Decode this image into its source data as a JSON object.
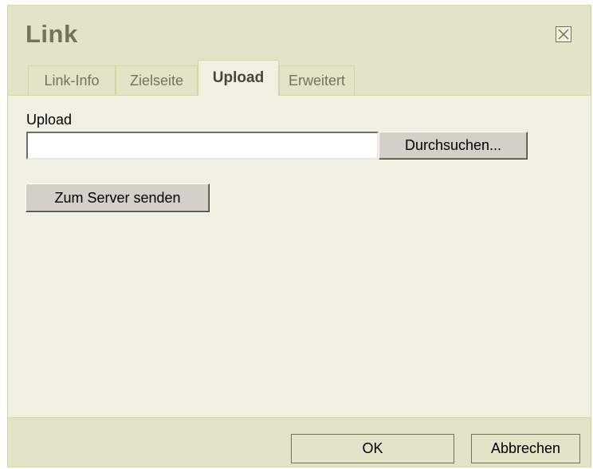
{
  "dialog": {
    "title": "Link"
  },
  "tabs": [
    {
      "label": "Link-Info",
      "active": false
    },
    {
      "label": "Zielseite",
      "active": false
    },
    {
      "label": "Upload",
      "active": true
    },
    {
      "label": "Erweitert",
      "active": false
    }
  ],
  "upload": {
    "label": "Upload",
    "file_value": "",
    "browse_label": "Durchsuchen...",
    "send_label": "Zum Server senden"
  },
  "footer": {
    "ok_label": "OK",
    "cancel_label": "Abbrechen"
  },
  "icons": {
    "close": "close-icon"
  },
  "colors": {
    "panel": "#f1f1e3",
    "header": "#e3e3c7",
    "border": "#d5d59d",
    "title_text": "#737357"
  }
}
